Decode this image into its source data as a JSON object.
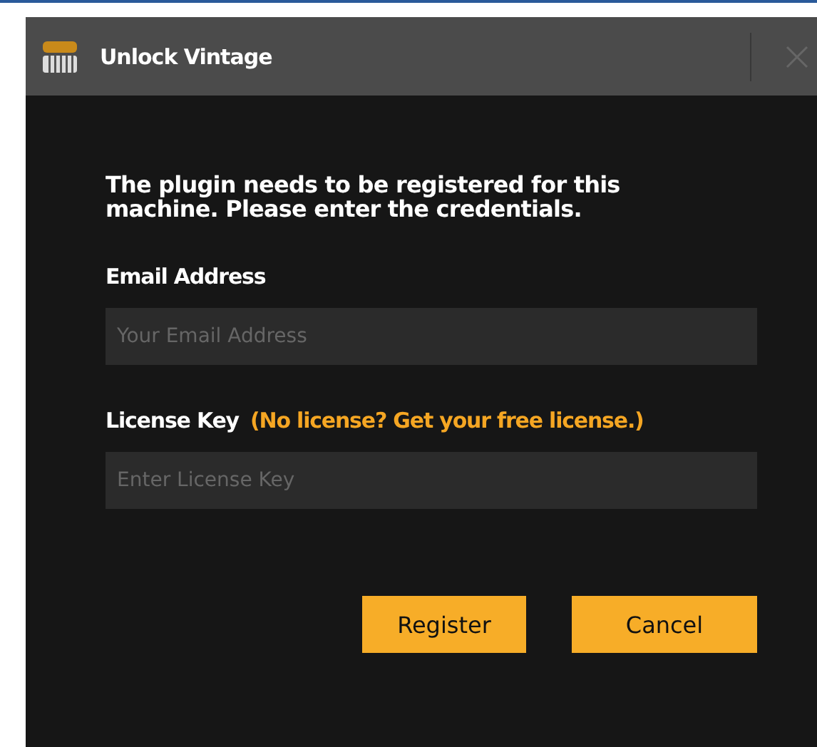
{
  "window": {
    "title": "Unlock Vintage"
  },
  "message": "The plugin needs to be registered for this machine. Please enter the credentials.",
  "email": {
    "label": "Email Address",
    "placeholder": "Your Email Address"
  },
  "license": {
    "label": "License Key",
    "link": "(No license? Get your free license.)",
    "placeholder": "Enter License Key"
  },
  "buttons": [
    "Register",
    "Cancel"
  ]
}
